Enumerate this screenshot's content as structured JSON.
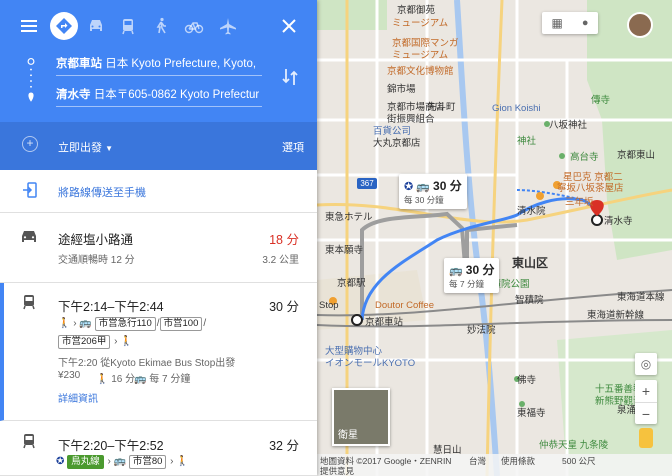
{
  "panel": {
    "from_main": "京都車站",
    "from_rest": " 日本 Kyoto Prefecture, Kyoto, ",
    "to_main": "清水寺",
    "to_rest": " 日本〒605-0862 Kyoto Prefectur",
    "depart_label": "立即出發",
    "options_label": "選項",
    "send_label": "將路線傳送至手機"
  },
  "routes": [
    {
      "title": "途經塩小路通",
      "duration": "18 分",
      "sub": "交通順暢時 12 分",
      "distance": "3.2 公里"
    },
    {
      "title": "下午2:14–下午2:44",
      "duration": "30 分",
      "chips_row1": [
        "市営急行110",
        "市営100"
      ],
      "chips_row2": [
        "市営206甲"
      ],
      "depart_info": "下午2:20 從Kyoto Ekimae Bus Stop出發",
      "fare": "¥230",
      "walk": "16 分",
      "freq": "每 7 分鐘",
      "details": "詳細資訊"
    },
    {
      "title": "下午2:20–下午2:52",
      "duration": "32 分",
      "chip_green": "烏丸線",
      "chip_bus": "市営80"
    }
  ],
  "map": {
    "labels": [
      "京都御苑",
      "ミュージアム",
      "京都文化博物館",
      "京都国際マンガ",
      "ミュージアム",
      "錦市場",
      "京都市場商店",
      "街振興組合",
      "先斗町",
      "Gion Koishi",
      "八坂神社",
      "傳寺",
      "神社",
      "百貨公司",
      "大丸京都店",
      "高台寺",
      "星巴克 京都二",
      "寧坂八坂茶屋店",
      "清水院",
      "三年坂",
      "清水寺",
      "東山区",
      "東本願寺",
      "東急ホテル",
      "京都駅",
      "Doutor Coffee",
      "京都車站",
      "Stop",
      "大型購物中心",
      "イオンモールKYOTO",
      "智積院公園",
      "智積院",
      "東福寺",
      "妙法院",
      "泉涌寺",
      "仲恭天皇 九条陵",
      "十五番善導寺",
      "新熊野觀音寺",
      "慧日山",
      "東海道本線",
      "東海道新幹線",
      "京都東山",
      "佛寺"
    ],
    "callout1": {
      "time": "30 分",
      "freq": "每 30 分鐘"
    },
    "callout2": {
      "time": "30 分",
      "freq": "每 7 分鐘"
    },
    "route_shield": "367",
    "satellite_label": "衛星",
    "footer": {
      "data": "地圖資料 ©2017 Google・ZENRIN",
      "region": "台灣",
      "terms": "使用條款",
      "scale": "500 公尺",
      "feedback": "提供意見"
    },
    "route_color": "#4285f4"
  }
}
